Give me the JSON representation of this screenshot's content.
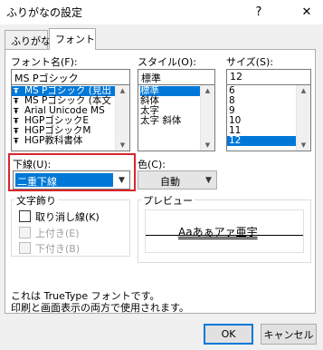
{
  "window": {
    "title": "ふりがなの設定",
    "help": "?",
    "close": "✕"
  },
  "tabs": [
    {
      "label": "ふりがな"
    },
    {
      "label": "フォント"
    }
  ],
  "font_name": {
    "label": "フォント名(F):",
    "value": "MS Pゴシック",
    "items": [
      {
        "label": "MS Pゴシック (見出",
        "selected": true
      },
      {
        "label": "MS Pゴシック (本文",
        "selected": false
      },
      {
        "label": "Arial Unicode MS",
        "selected": false
      },
      {
        "label": "HGPゴシックE",
        "selected": false
      },
      {
        "label": "HGPゴシックM",
        "selected": false
      },
      {
        "label": "HGP教科書体",
        "selected": false
      }
    ]
  },
  "style": {
    "label": "スタイル(O):",
    "value": "標準",
    "items": [
      {
        "label": "標準",
        "selected": true
      },
      {
        "label": "斜体",
        "selected": false
      },
      {
        "label": "太字",
        "selected": false
      },
      {
        "label": "太字 斜体",
        "selected": false
      }
    ]
  },
  "size": {
    "label": "サイズ(S):",
    "value": "12",
    "items": [
      {
        "label": "6",
        "selected": false
      },
      {
        "label": "8",
        "selected": false
      },
      {
        "label": "9",
        "selected": false
      },
      {
        "label": "10",
        "selected": false
      },
      {
        "label": "11",
        "selected": false
      },
      {
        "label": "12",
        "selected": true
      }
    ]
  },
  "underline": {
    "label": "下線(U):",
    "value": "二重下線"
  },
  "color": {
    "label": "色(C):",
    "value": "自動"
  },
  "effects": {
    "label": "文字飾り",
    "strikethrough": "取り消し線(K)",
    "superscript": "上付き(E)",
    "subscript": "下付き(B)"
  },
  "preview": {
    "label": "プレビュー",
    "sample": "Aaあぁアァ亜宇"
  },
  "note": {
    "line1": "これは TrueType フォントです。",
    "line2": "印刷と画面表示の両方で使用されます。"
  },
  "buttons": {
    "ok": "OK",
    "cancel": "キャンセル"
  },
  "icons": {
    "truetype": "Ŧ",
    "dropdown": "▼",
    "scroll_up": "▲",
    "scroll_down": "▼"
  },
  "colors": {
    "selection": "#0078d7",
    "highlight": "#d9252b"
  }
}
